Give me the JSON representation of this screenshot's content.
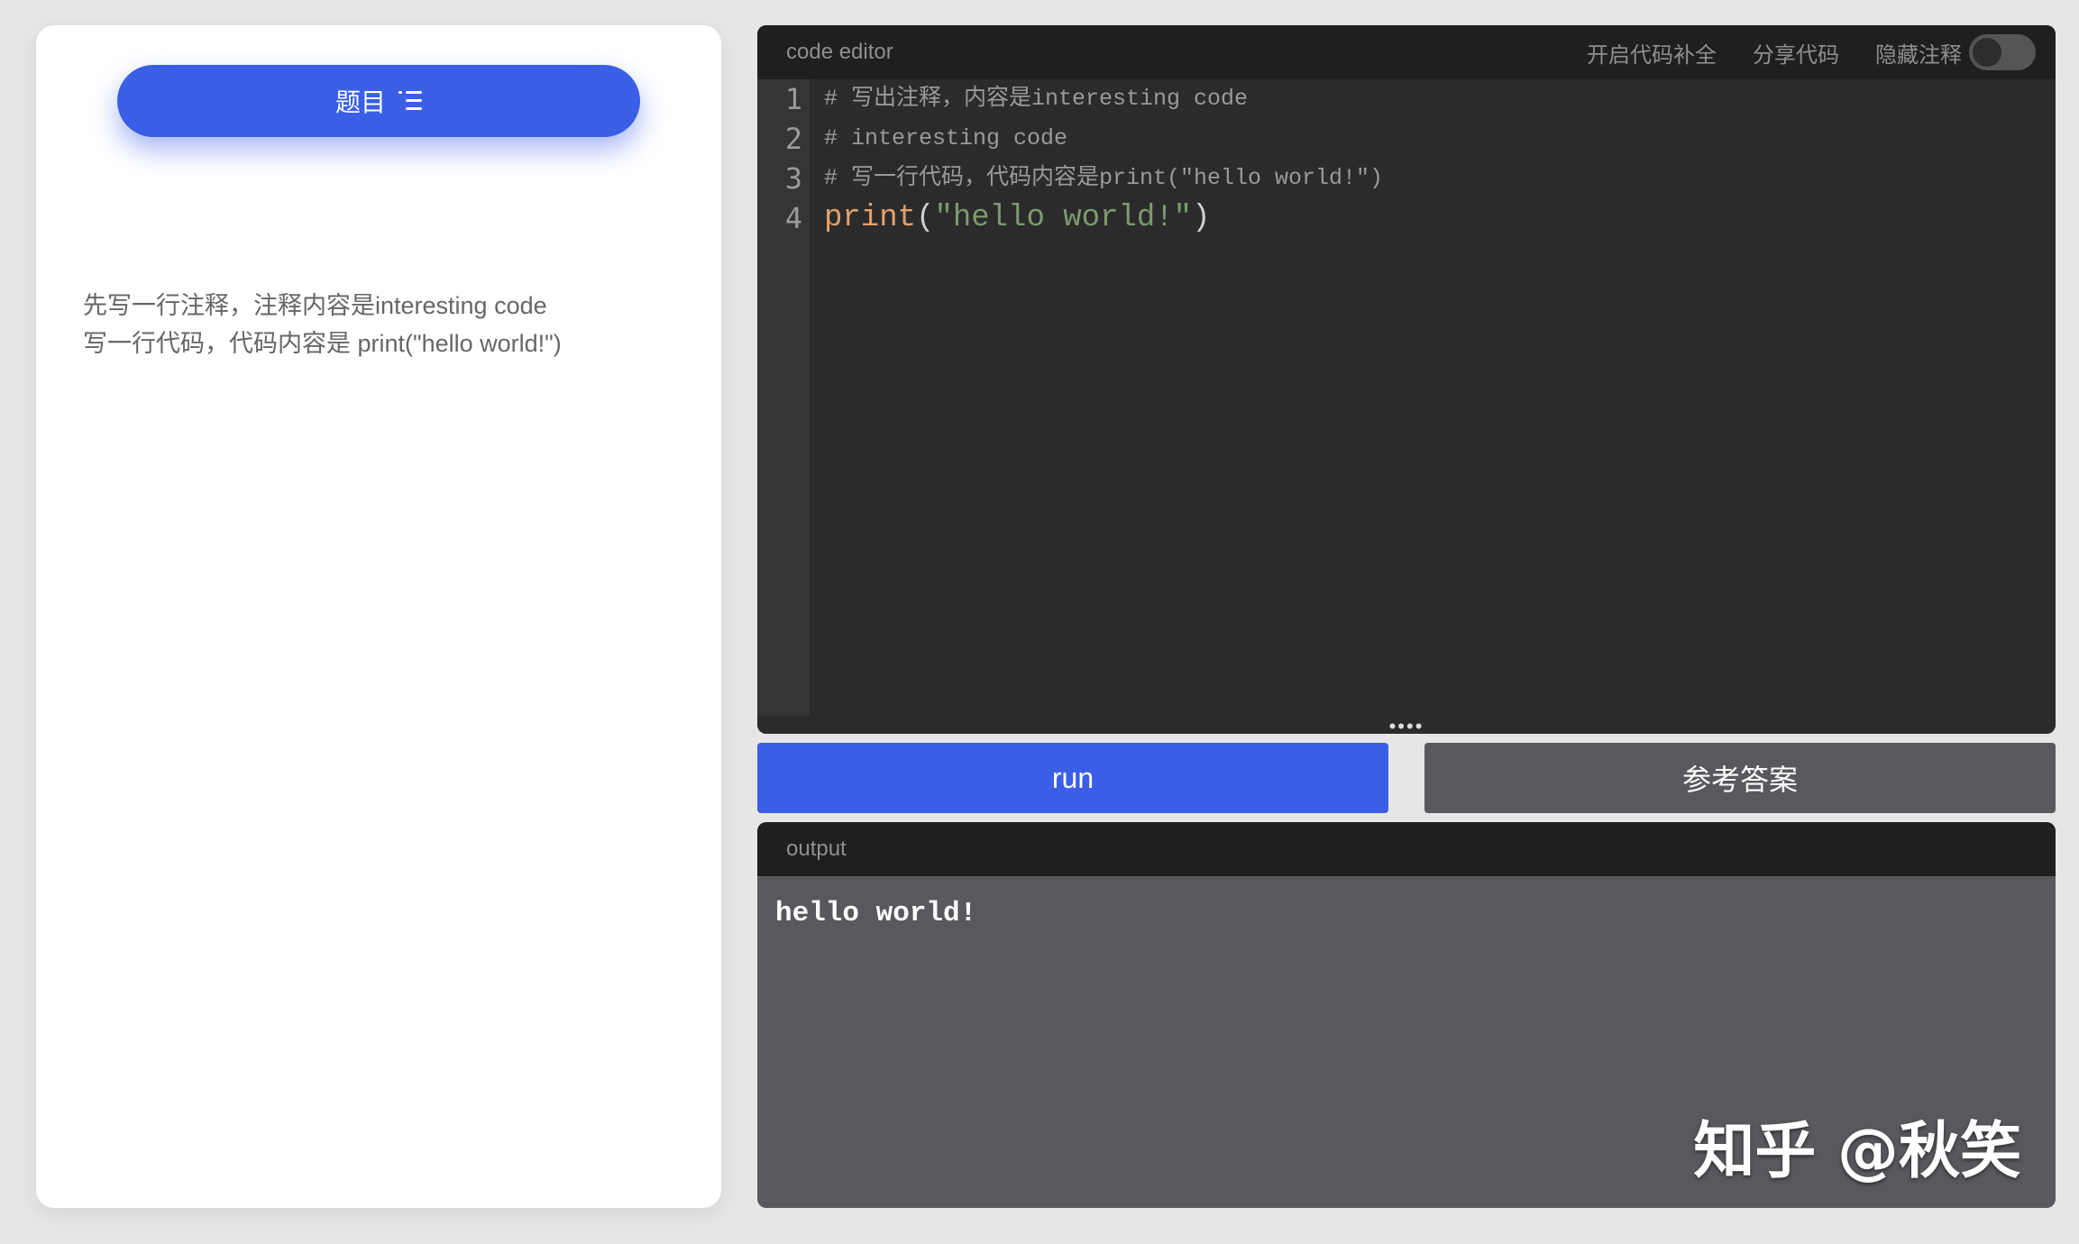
{
  "left_panel": {
    "topic_button_label": "题目",
    "problem_lines": [
      "先写一行注释，注释内容是interesting code",
      "写一行代码，代码内容是 print(\"hello world!\")"
    ]
  },
  "editor": {
    "title": "code editor",
    "autocomplete_label": "开启代码补全",
    "share_label": "分享代码",
    "hide_comments_label": "隐藏注释",
    "hide_comments_enabled": false,
    "line_numbers": [
      "1",
      "2",
      "3",
      "4"
    ],
    "lines": [
      "# 写出注释，内容是interesting code",
      "# interesting code",
      "# 写一行代码，代码内容是print(\"hello world!\")"
    ],
    "code_keyword": "print",
    "code_open": "(",
    "code_string": "\"hello world!\"",
    "code_close": ")",
    "resize_handle": "••••"
  },
  "actions": {
    "run_label": "run",
    "answer_label": "参考答案"
  },
  "output": {
    "title": "output",
    "text": "hello world!",
    "watermark": "知乎 @秋笑"
  },
  "colors": {
    "accent": "#3a5fe6",
    "editor_bg": "#2b2b2b",
    "header_bg": "#1f1f1f",
    "output_bg": "#58595d"
  }
}
